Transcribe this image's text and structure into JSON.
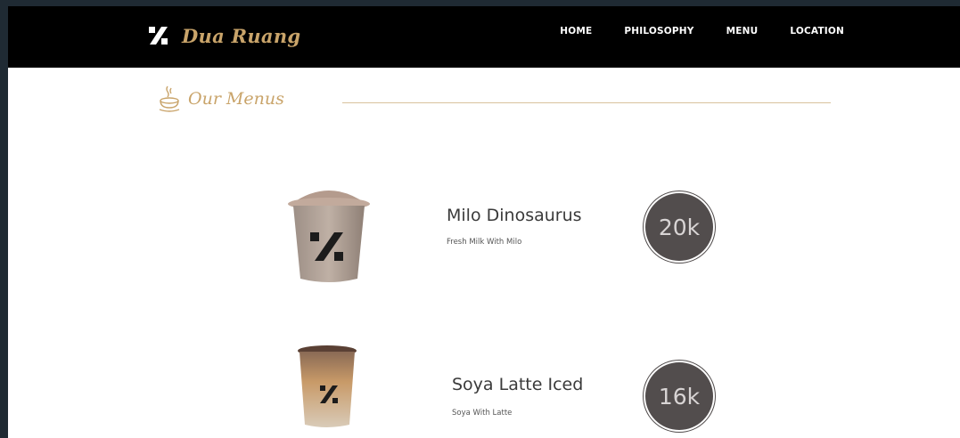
{
  "header": {
    "brand_name": "Dua Ruang",
    "logo_icon": "percent-logo-icon",
    "nav": [
      {
        "label": "HOME"
      },
      {
        "label": "PHILOSOPHY"
      },
      {
        "label": "MENU"
      },
      {
        "label": "LOCATION"
      }
    ]
  },
  "section": {
    "title": "Our Menus",
    "icon": "coffee-cup-icon"
  },
  "menu": {
    "items": [
      {
        "name": "Milo Dinosaurus",
        "description": "Fresh Milk With Milo",
        "price": "20k"
      },
      {
        "name": "Soya Latte Iced",
        "description": "Soya With Latte",
        "price": "16k"
      }
    ]
  },
  "colors": {
    "accent": "#c9a46a",
    "navbar": "#000000",
    "badge": "#524d4d",
    "page_border": "#1f2a33"
  }
}
